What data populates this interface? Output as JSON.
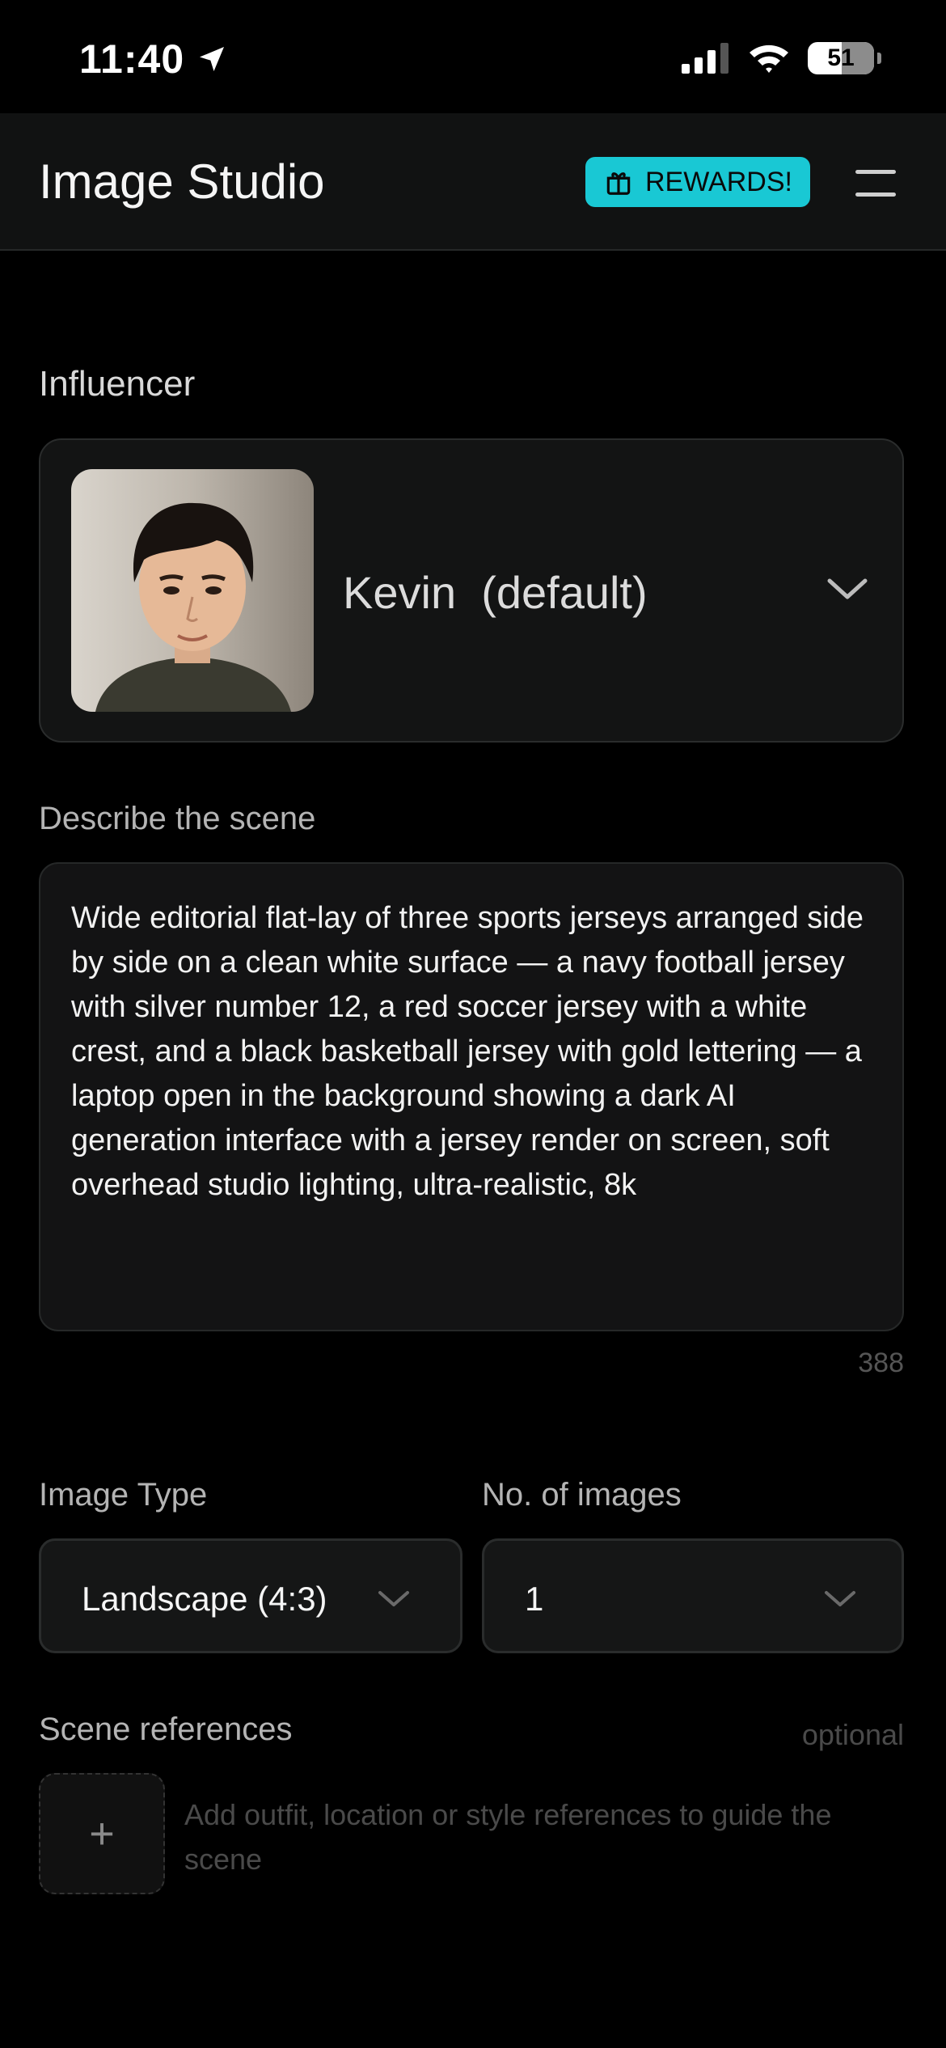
{
  "status_bar": {
    "time": "11:40",
    "battery": "51"
  },
  "header": {
    "title": "Image Studio",
    "rewards_label": "REWARDS!"
  },
  "influencer": {
    "section_label": "Influencer",
    "name": "Kevin  (default)"
  },
  "scene": {
    "label": "Describe the scene",
    "text": "Wide editorial flat-lay of three sports jerseys arranged side by side on a clean white surface — a navy football jersey with silver number 12, a red soccer jersey with a white crest, and a black basketball jersey with gold lettering — a laptop open in the background showing a dark AI generation interface with a jersey render on screen, soft overhead studio lighting, ultra-realistic, 8k",
    "char_count": "388"
  },
  "image_type": {
    "label": "Image Type",
    "value": "Landscape (4:3)"
  },
  "num_images": {
    "label": "No. of images",
    "value": "1"
  },
  "scene_references": {
    "label": "Scene references",
    "optional": "optional",
    "add_symbol": "+",
    "hint": "Add outfit, location or style references to guide the scene"
  },
  "colors": {
    "accent": "#19c8d4",
    "background": "#000000",
    "surface": "#131414"
  },
  "icons": [
    "location-arrow-icon",
    "signal-icon",
    "wifi-icon",
    "battery-icon",
    "gift-icon",
    "menu-icon",
    "chevron-down-icon"
  ]
}
